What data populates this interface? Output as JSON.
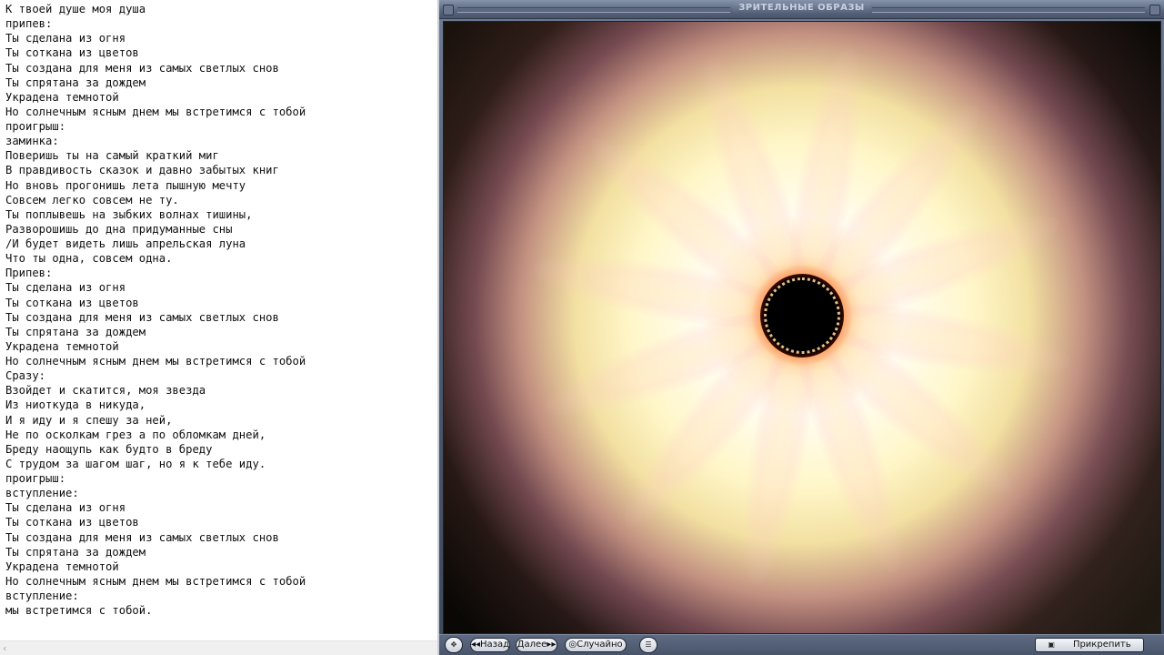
{
  "editor": {
    "lines": [
      "К твоей душе моя душа",
      "припев:",
      "Ты сделана из огня",
      "Ты соткана из цветов",
      "Ты создана для меня из самых светлых снов",
      "Ты спрятана за дождем",
      "Украдена темнотой",
      "Но солнечным ясным днем мы встретимся с тобой",
      "проигрыш:",
      "заминка:",
      "Поверишь ты на самый краткий миг",
      "В правдивость сказок и давно забытых книг",
      "Но вновь прогонишь лета пышную мечту",
      "Совсем легко совсем не ту.",
      "Ты поплывешь на зыбких волнах тишины,",
      "Разворошишь до дна придуманные сны",
      "/И будет видеть лишь апрельская луна",
      "Что ты одна, совсем одна.",
      "Припев:",
      "Ты сделана из огня",
      "Ты соткана из цветов",
      "Ты создана для меня из самых светлых снов",
      "Ты спрятана за дождем",
      "Украдена темнотой",
      "Но солнечным ясным днем мы встретимся с тобой",
      "Сразу:",
      "Взойдет и скатится, моя звезда",
      "Из ниоткуда в никуда,",
      "И я иду и я спешу за ней,",
      "Не по осколкам грез а по обломкам дней,",
      "Бреду наощупь как будто в бреду",
      "С трудом за шагом шаг, но я к тебе иду.",
      "проигрыш:",
      "вступление:",
      "Ты сделана из огня",
      "Ты соткана из цветов",
      "Ты создана для меня из самых светлых снов",
      "Ты спрятана за дождем",
      "Украдена темнотой",
      "Но солнечным ясным днем мы встретимся с тобой",
      "вступление:",
      "мы встретимся с тобой."
    ],
    "scroll_left_glyph": "‹"
  },
  "visualization": {
    "title": "ЗРИТЕЛЬНЫЕ ОБРАЗЫ",
    "toolbar": {
      "back_label": "◂◂Назад",
      "next_label": "Далее▸▸",
      "random_label": "◎Случайно",
      "pin_label": "Прикрепить"
    }
  },
  "colors": {
    "frame": "#4d5a70",
    "button_face": "#dde2ea",
    "glow_core": "#fffdf0"
  }
}
